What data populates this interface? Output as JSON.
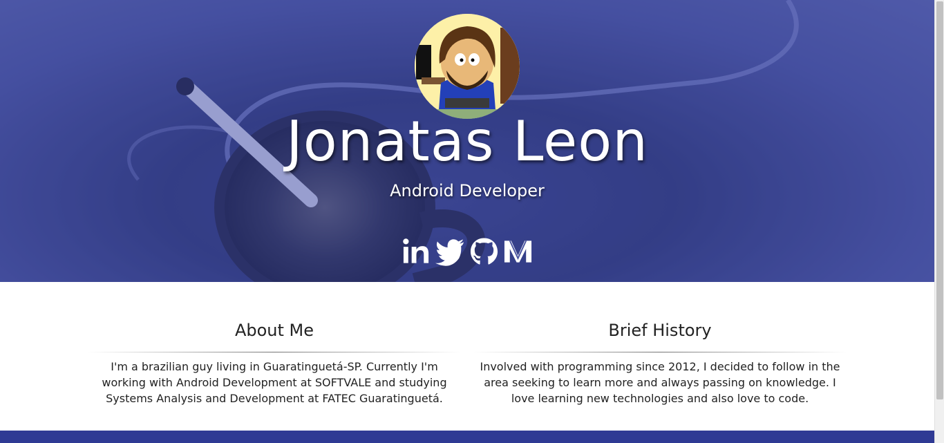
{
  "hero": {
    "name": "Jonatas Leon",
    "role": "Android Developer",
    "social": [
      {
        "icon": "linkedin-icon"
      },
      {
        "icon": "twitter-icon"
      },
      {
        "icon": "github-icon"
      },
      {
        "icon": "medium-icon"
      }
    ]
  },
  "about": {
    "heading": "About Me",
    "text": "I'm a brazilian guy living in Guaratinguetá-SP. Currently I'm working with Android Development at SOFTVALE and studying Systems Analysis and Development at FATEC Guaratinguetá."
  },
  "history": {
    "heading": "Brief History",
    "text": "Involved with programming since 2012, I decided to follow in the area seeking to learn more and always passing on knowledge. I love learning new technologies and also love to code."
  },
  "colors": {
    "hero_tint": "#3c48a0",
    "footer_band": "#2f3a94",
    "text": "#222222"
  }
}
